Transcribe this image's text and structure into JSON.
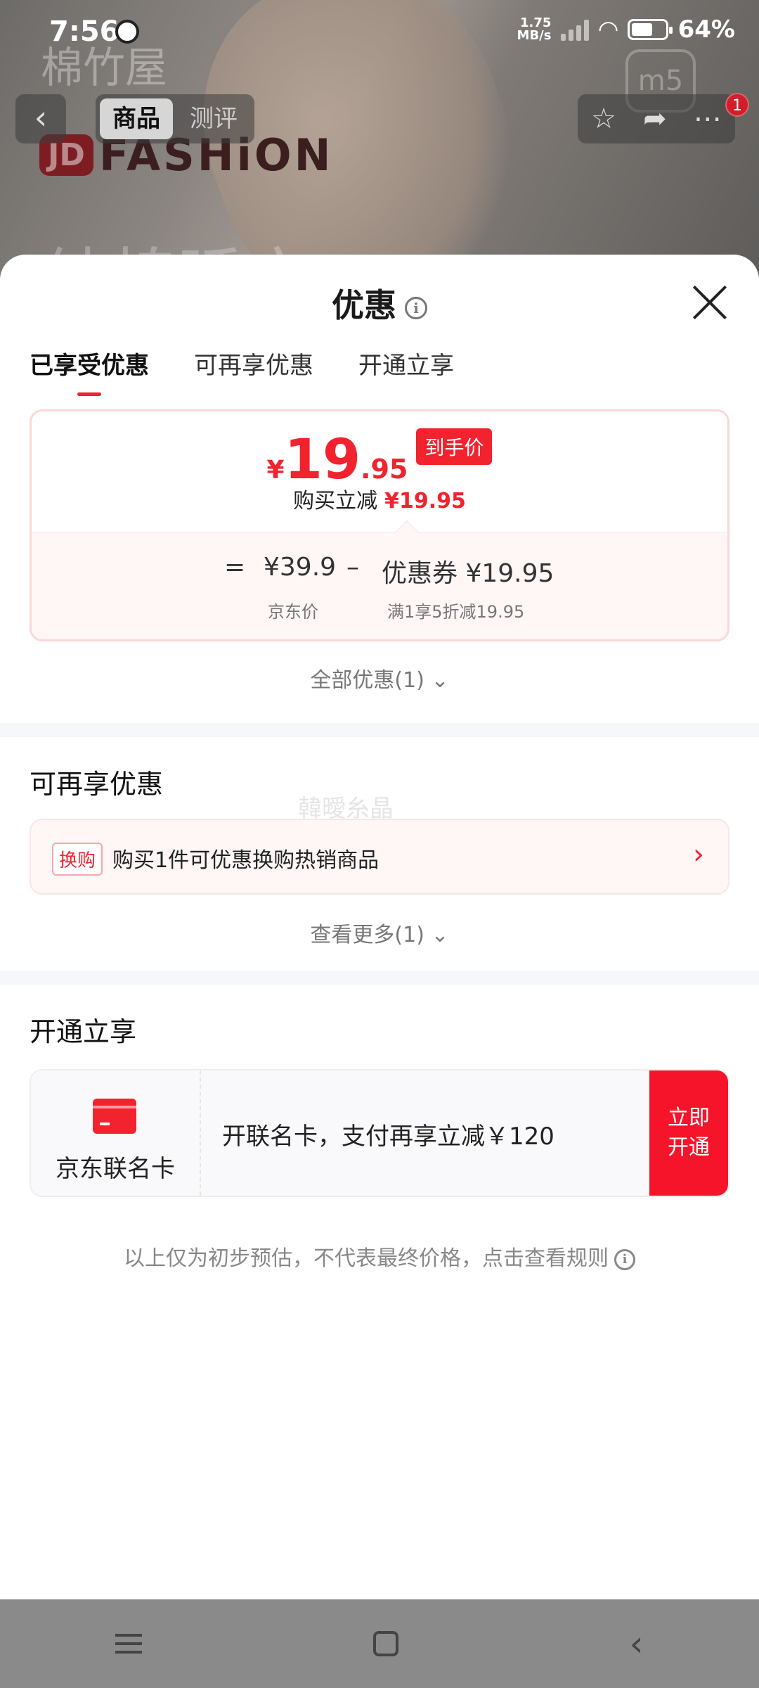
{
  "status_bar": {
    "time": "7:56",
    "net_speed_value": "1.75",
    "net_speed_unit": "MB/s",
    "battery": "64%",
    "battery_level": 0.64
  },
  "background": {
    "brand": "棉竹屋",
    "logo_jd": "JD",
    "logo_text": "FASHiON",
    "headline_partial": "纯棉睡衣",
    "corner_badge": "m5"
  },
  "top_nav": {
    "tabs": [
      "商品",
      "测评"
    ],
    "active_tab": 0,
    "badge_count": "1"
  },
  "sheet": {
    "title": "优惠",
    "tabs": [
      "已享受优惠",
      "可再享优惠",
      "开通立享"
    ],
    "active_tab": 0
  },
  "price_card": {
    "currency": "¥",
    "price_int": "19",
    "price_dec": ".95",
    "price_tag": "到手价",
    "discount_label": "购买立减",
    "discount_value": "¥19.95",
    "equals": "=",
    "minus": "–",
    "jd_price": "¥39.9",
    "jd_price_label": "京东价",
    "coupon": "优惠券 ¥19.95",
    "coupon_label": "满1享5折减19.95"
  },
  "all_offers": "全部优惠(1)",
  "more_offers": {
    "title": "可再享优惠",
    "watermark": "韓曖糸晶",
    "swap_tag": "换购",
    "swap_text": "购买1件可优惠换购热销商品",
    "view_more": "查看更多(1)"
  },
  "open_enjoy": {
    "title": "开通立享",
    "card_name": "京东联名卡",
    "card_text": "开联名卡，支付再享立减￥120",
    "btn_line1": "立即",
    "btn_line2": "开通"
  },
  "disclaimer": "以上仅为初步预估，不代表最终价格，点击查看规则",
  "colors": {
    "accent": "#f2222f",
    "card_button": "#f5142a"
  }
}
